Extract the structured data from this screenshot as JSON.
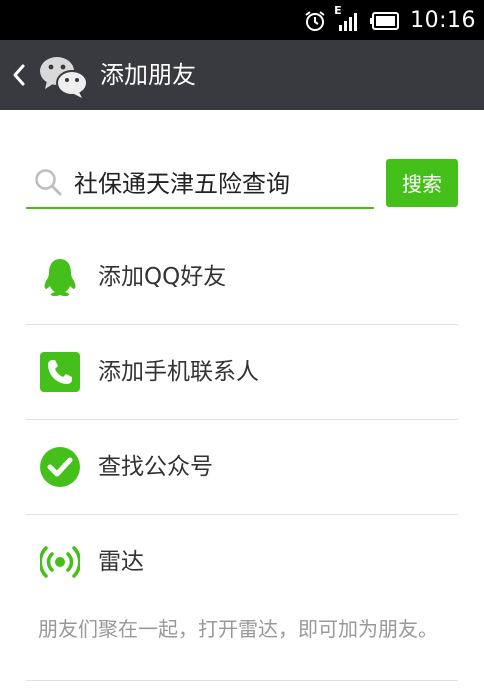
{
  "status_bar": {
    "time": "10:16",
    "network_label": "E",
    "icons": [
      "alarm-icon",
      "signal-icon",
      "battery-icon"
    ]
  },
  "header": {
    "title": "添加朋友",
    "icons": [
      "back-chevron-icon",
      "wechat-logo-icon"
    ]
  },
  "search": {
    "value": "社保通天津五险查询",
    "placeholder": "",
    "button_label": "搜索"
  },
  "menu": {
    "items": [
      {
        "label": "添加QQ好友",
        "icon": "qq-penguin-icon"
      },
      {
        "label": "添加手机联系人",
        "icon": "phone-contact-icon"
      },
      {
        "label": "查找公众号",
        "icon": "checkmark-circle-icon"
      },
      {
        "label": "雷达",
        "icon": "radar-icon"
      }
    ],
    "radar_description": "朋友们聚在一起，打开雷达，即可加为朋友。"
  },
  "colors": {
    "accent": "#45c01a",
    "header_bg": "#393a3f",
    "status_bg": "#000000",
    "divider": "#e2e2e2",
    "hint_text": "#999999"
  }
}
